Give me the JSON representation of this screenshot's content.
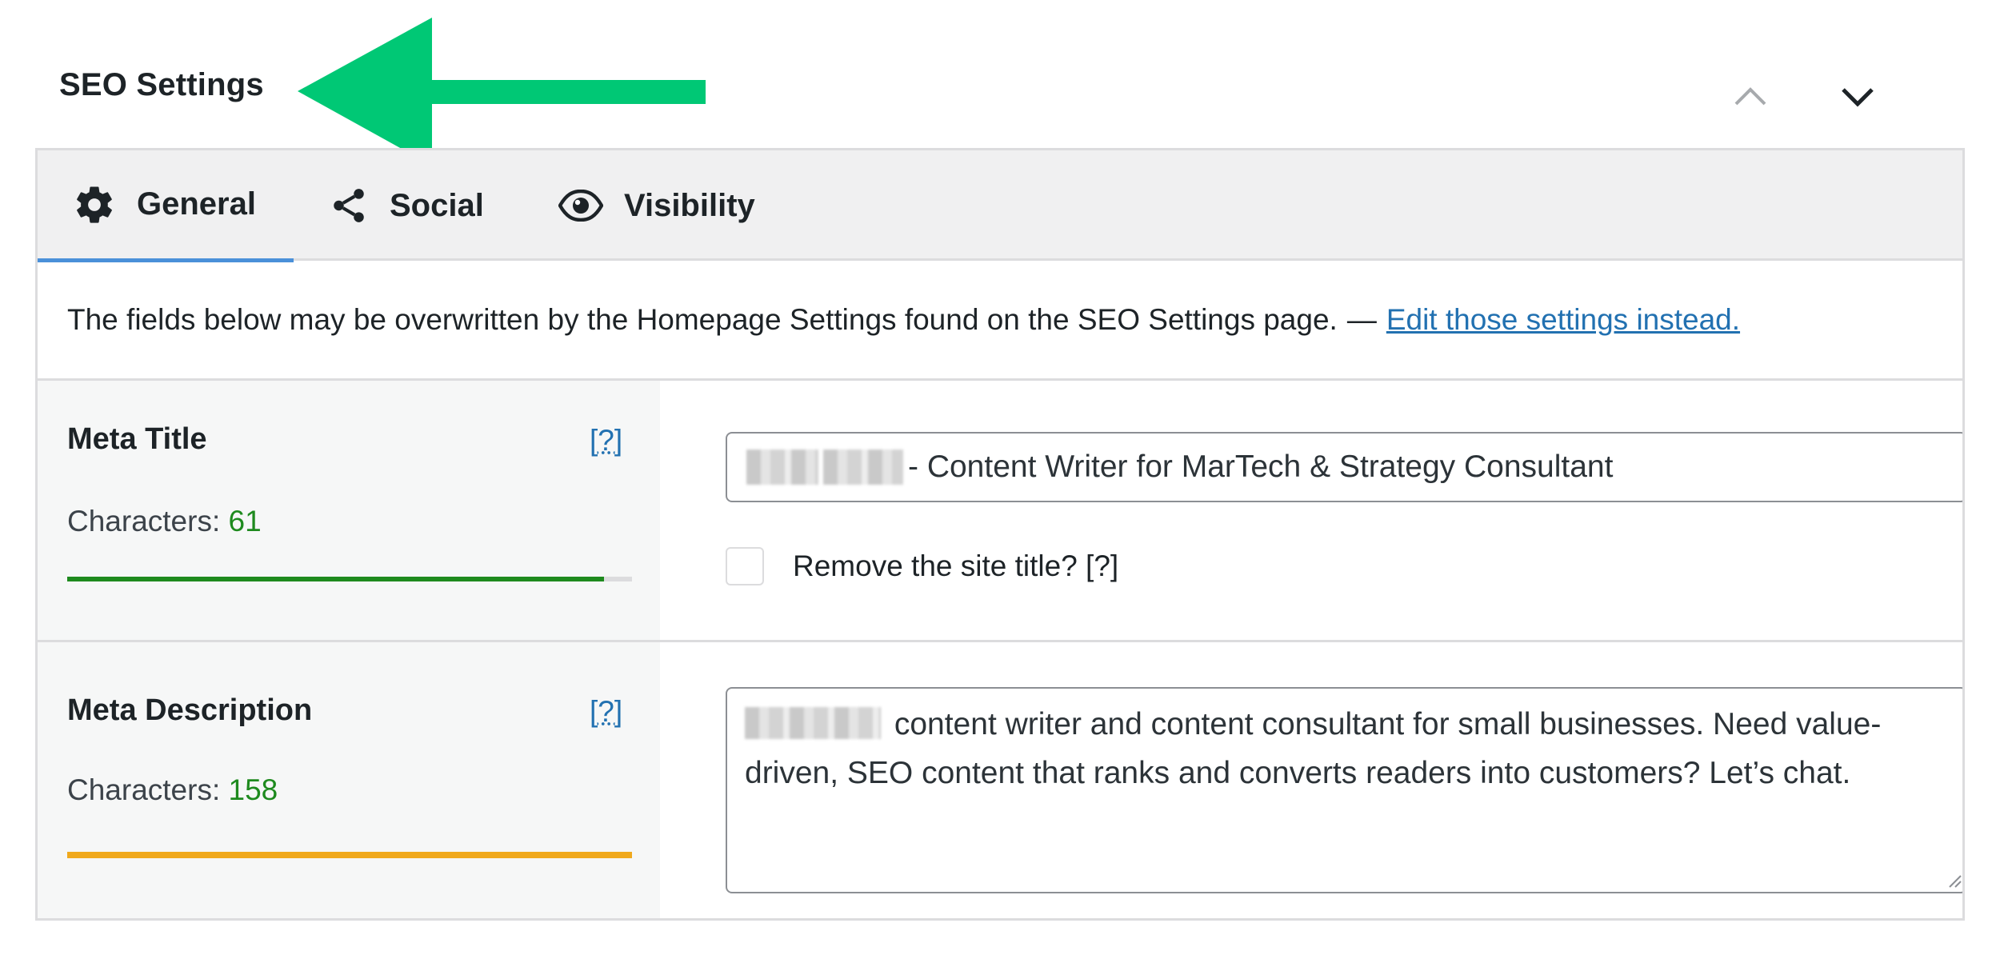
{
  "header": {
    "title": "SEO Settings",
    "arrow_color": "#00c875"
  },
  "tabs": [
    {
      "label": "General",
      "icon": "gear-icon",
      "active": true
    },
    {
      "label": "Social",
      "icon": "share-icon",
      "active": false
    },
    {
      "label": "Visibility",
      "icon": "eye-icon",
      "active": false
    }
  ],
  "notice": {
    "text": "The fields below may be overwritten by the Homepage Settings found on the SEO Settings page.",
    "separator": "—",
    "link_text": "Edit those settings instead."
  },
  "meta_title": {
    "label": "Meta Title",
    "help": "[?]",
    "characters_label": "Characters:",
    "characters_count": "61",
    "bar_fill_fraction": 0.95,
    "bar_color": "#1e8a1e",
    "value": "- Content Writer for MarTech & Strategy Consultant",
    "checkbox_label": "Remove the site title? [?]",
    "checkbox_checked": false
  },
  "meta_description": {
    "label": "Meta Description",
    "help": "[?]",
    "characters_label": "Characters:",
    "characters_count": "158",
    "bar_fill_fraction": 1.0,
    "bar_color": "#f0a91d",
    "value": "content writer and content consultant for small businesses. Need value-driven, SEO content that ranks and converts  readers into customers? Let’s chat."
  },
  "colors": {
    "link": "#2271b1",
    "active_tab_underline": "#4a90d9",
    "count_green": "#1e8a1e"
  }
}
